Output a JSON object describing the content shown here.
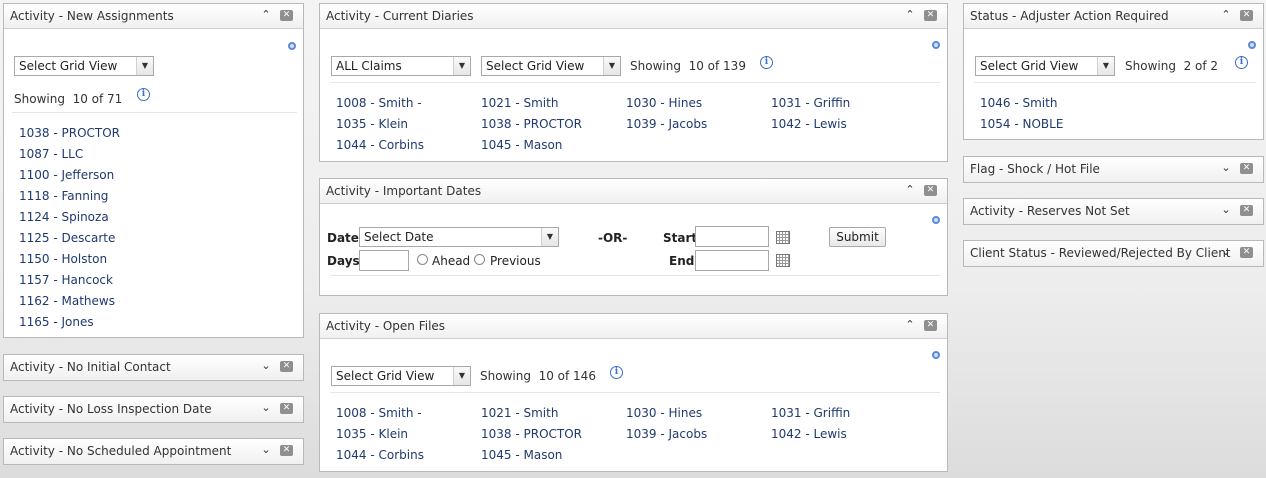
{
  "panels": {
    "new_assignments": {
      "title": "Activity - New Assignments",
      "grid_view": "Select Grid View",
      "showing_label": "Showing",
      "showing_count": "10 of 71",
      "items": [
        "1038 - PROCTOR",
        "1087 - LLC",
        "1100 - Jefferson",
        "1118 - Fanning",
        "1124 - Spinoza",
        "1125 - Descarte",
        "1150 - Holston",
        "1157 - Hancock",
        "1162 - Mathews",
        "1165 - Jones"
      ]
    },
    "no_initial_contact": {
      "title": "Activity - No Initial Contact"
    },
    "no_loss_inspection": {
      "title": "Activity - No Loss Inspection Date"
    },
    "no_scheduled_appt": {
      "title": "Activity - No Scheduled Appointment"
    },
    "current_diaries": {
      "title": "Activity - Current Diaries",
      "claims_filter": "ALL Claims",
      "grid_view": "Select Grid View",
      "showing_label": "Showing",
      "showing_count": "10 of 139",
      "items": [
        "1008 - Smith -",
        "1021 - Smith",
        "1030 - Hines",
        "1031 - Griffin",
        "1035 - Klein",
        "1038 - PROCTOR",
        "1039 - Jacobs",
        "1042 - Lewis",
        "1044 - Corbins",
        "1045 - Mason"
      ]
    },
    "important_dates": {
      "title": "Activity - Important Dates",
      "date_label": "Date:",
      "date_select": "Select Date",
      "or_label": "-OR-",
      "start_label": "Start:",
      "end_label": "End:",
      "days_label": "Days:",
      "ahead_label": "Ahead",
      "previous_label": "Previous",
      "submit_label": "Submit"
    },
    "open_files": {
      "title": "Activity - Open Files",
      "grid_view": "Select Grid View",
      "showing_label": "Showing",
      "showing_count": "10 of 146",
      "items": [
        "1008 - Smith -",
        "1021 - Smith",
        "1030 - Hines",
        "1031 - Griffin",
        "1035 - Klein",
        "1038 - PROCTOR",
        "1039 - Jacobs",
        "1042 - Lewis",
        "1044 - Corbins",
        "1045 - Mason"
      ]
    },
    "adjuster_action": {
      "title": "Status - Adjuster Action Required",
      "grid_view": "Select Grid View",
      "showing_label": "Showing",
      "showing_count": "2 of 2",
      "items": [
        "1046 - Smith",
        "1054 - NOBLE"
      ]
    },
    "shock_hot_file": {
      "title": "Flag - Shock / Hot File"
    },
    "reserves_not_set": {
      "title": "Activity - Reserves Not Set"
    },
    "client_status": {
      "title": "Client Status - Reviewed/Rejected By Client"
    }
  },
  "icons": {
    "collapse": "chevron-up-icon",
    "expand": "chevron-down-icon",
    "close": "close-icon",
    "settings": "gear-icon",
    "info": "info-icon",
    "calendar": "calendar-icon"
  },
  "colors": {
    "link": "#1f3a6e",
    "info": "#3c6fc8",
    "close_button": "#8f8f8f"
  }
}
